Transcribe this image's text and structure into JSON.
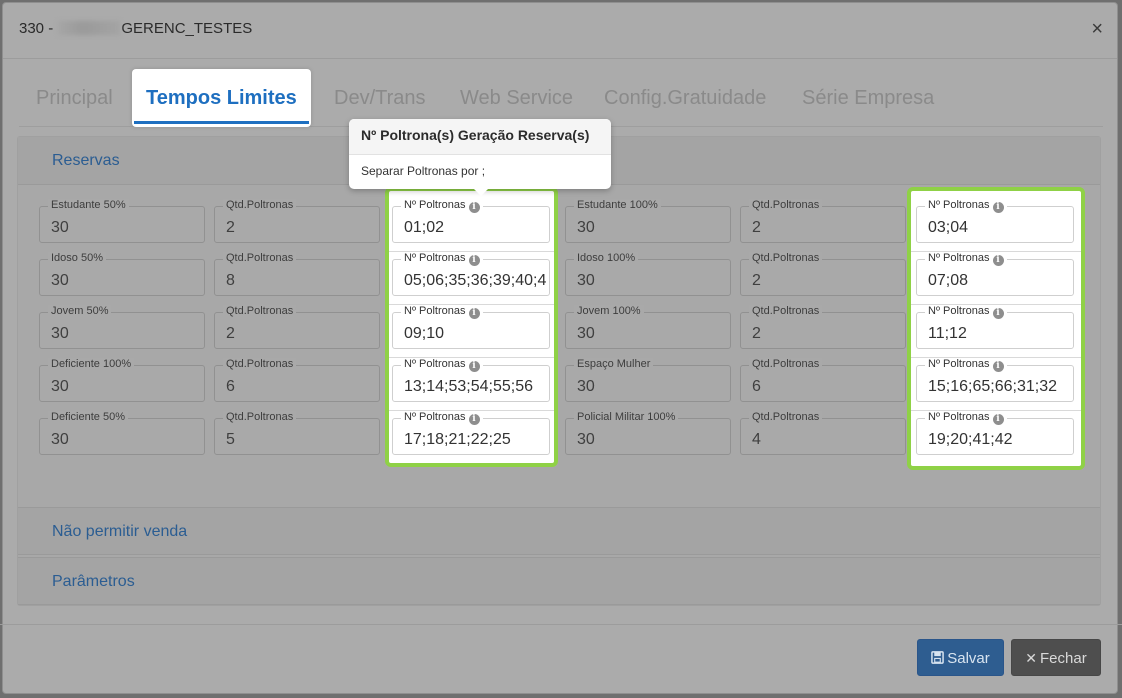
{
  "modal": {
    "title_prefix": "330 -",
    "title_suffix": "GERENC_TESTES",
    "close_glyph": "×"
  },
  "tabs": [
    {
      "label": "Principal",
      "active": false
    },
    {
      "label": "Tempos Limites",
      "active": true
    },
    {
      "label": "Dev/Trans",
      "active": false
    },
    {
      "label": "Web Service",
      "active": false
    },
    {
      "label": "Config.Gratuidade",
      "active": false
    },
    {
      "label": "Série Empresa",
      "active": false
    }
  ],
  "sections": {
    "reservas": "Reservas",
    "nao_permitir": "Não permitir venda",
    "parametros": "Parâmetros"
  },
  "tooltip": {
    "title": "Nº Poltrona(s) Geração Reserva(s)",
    "body": "Separar Poltronas por ;"
  },
  "rows": [
    {
      "left": {
        "label": "Estudante 50%",
        "value": "30",
        "qtd_label": "Qtd.Poltronas",
        "qtd": "2",
        "np_label": "Nº Poltronas",
        "np": "01;02"
      },
      "right": {
        "label": "Estudante 100%",
        "value": "30",
        "qtd_label": "Qtd.Poltronas",
        "qtd": "2",
        "np_label": "Nº Poltronas",
        "np": "03;04"
      }
    },
    {
      "left": {
        "label": "Idoso 50%",
        "value": "30",
        "qtd_label": "Qtd.Poltronas",
        "qtd": "8",
        "np_label": "Nº Poltronas",
        "np": "05;06;35;36;39;40;4"
      },
      "right": {
        "label": "Idoso 100%",
        "value": "30",
        "qtd_label": "Qtd.Poltronas",
        "qtd": "2",
        "np_label": "Nº Poltronas",
        "np": "07;08"
      }
    },
    {
      "left": {
        "label": "Jovem 50%",
        "value": "30",
        "qtd_label": "Qtd.Poltronas",
        "qtd": "2",
        "np_label": "Nº Poltronas",
        "np": "09;10"
      },
      "right": {
        "label": "Jovem 100%",
        "value": "30",
        "qtd_label": "Qtd.Poltronas",
        "qtd": "2",
        "np_label": "Nº Poltronas",
        "np": "11;12"
      }
    },
    {
      "left": {
        "label": "Deficiente 100%",
        "value": "30",
        "qtd_label": "Qtd.Poltronas",
        "qtd": "6",
        "np_label": "Nº Poltronas",
        "np": "13;14;53;54;55;56"
      },
      "right": {
        "label": "Espaço Mulher",
        "value": "30",
        "qtd_label": "Qtd.Poltronas",
        "qtd": "6",
        "np_label": "Nº Poltronas",
        "np": "15;16;65;66;31;32"
      }
    },
    {
      "left": {
        "label": "Deficiente 50%",
        "value": "30",
        "qtd_label": "Qtd.Poltronas",
        "qtd": "5",
        "np_label": "Nº Poltronas",
        "np": "17;18;21;22;25"
      },
      "right": {
        "label": "Policial Militar 100%",
        "value": "30",
        "qtd_label": "Qtd.Poltronas",
        "qtd": "4",
        "np_label": "Nº Poltronas",
        "np": "19;20;41;42"
      }
    }
  ],
  "buttons": {
    "save": "Salvar",
    "close": "Fechar"
  },
  "icons": {
    "save": "floppy-disk-icon",
    "close": "x-icon",
    "info": "info-icon"
  },
  "colors": {
    "highlight": "#8fd146",
    "accent": "#1e6fc0",
    "save_button": "#2e5d90",
    "close_button": "#4e4e4e"
  }
}
